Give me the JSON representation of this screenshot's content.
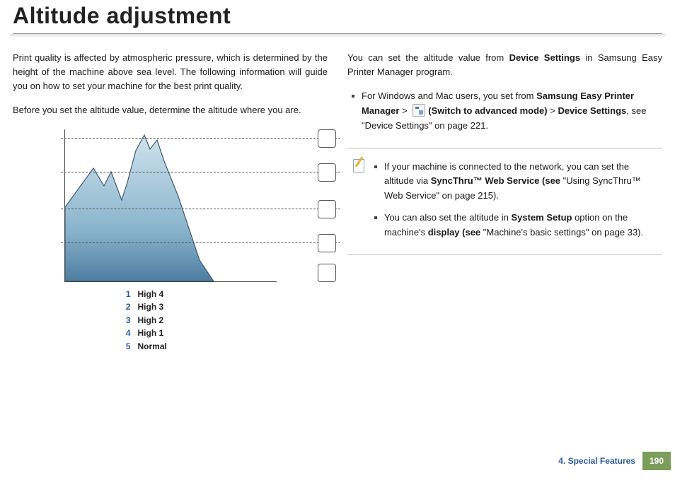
{
  "title": "Altitude adjustment",
  "left": {
    "p1": "Print quality is affected by atmospheric pressure, which is determined by the height of the machine above sea level. The following information will guide you on how to set your machine for the best print quality.",
    "p2": "Before you set the altitude value, determine the altitude where you are."
  },
  "legend": [
    {
      "num": "1",
      "label": "High 4"
    },
    {
      "num": "2",
      "label": "High 3"
    },
    {
      "num": "3",
      "label": "High 2"
    },
    {
      "num": "4",
      "label": "High 1"
    },
    {
      "num": "5",
      "label": "Normal"
    }
  ],
  "right": {
    "intro_pre": "You can set the altitude value from ",
    "intro_bold1": "Device Settings",
    "intro_mid": " in Samsung Easy Printer Manager program.",
    "bul1_pre": "For Windows and Mac users, you set from ",
    "bul1_b1": "Samsung Easy Printer Manager",
    "bul1_gt1": " > ",
    "bul1_b2": "(Switch to advanced mode)",
    "bul1_gt2": "  > ",
    "bul1_b3": " Device Settings",
    "bul1_post": ", see \"Device Settings\" on page 221."
  },
  "note": {
    "n1_pre": "If your machine is connected to the network, you can set the altitude via ",
    "n1_b1": "SyncThru™ Web Service (see ",
    "n1_post": "\"Using SyncThru™ Web Service\" on page 215).",
    "n2_pre": "You can also set the altitude in ",
    "n2_b1": "System Setup",
    "n2_mid": " option on the machine's ",
    "n2_b2": "display (see ",
    "n2_post": "\"Machine's basic settings\" on page 33)."
  },
  "footer": {
    "chapter": "4.  Special Features",
    "page": "190"
  }
}
